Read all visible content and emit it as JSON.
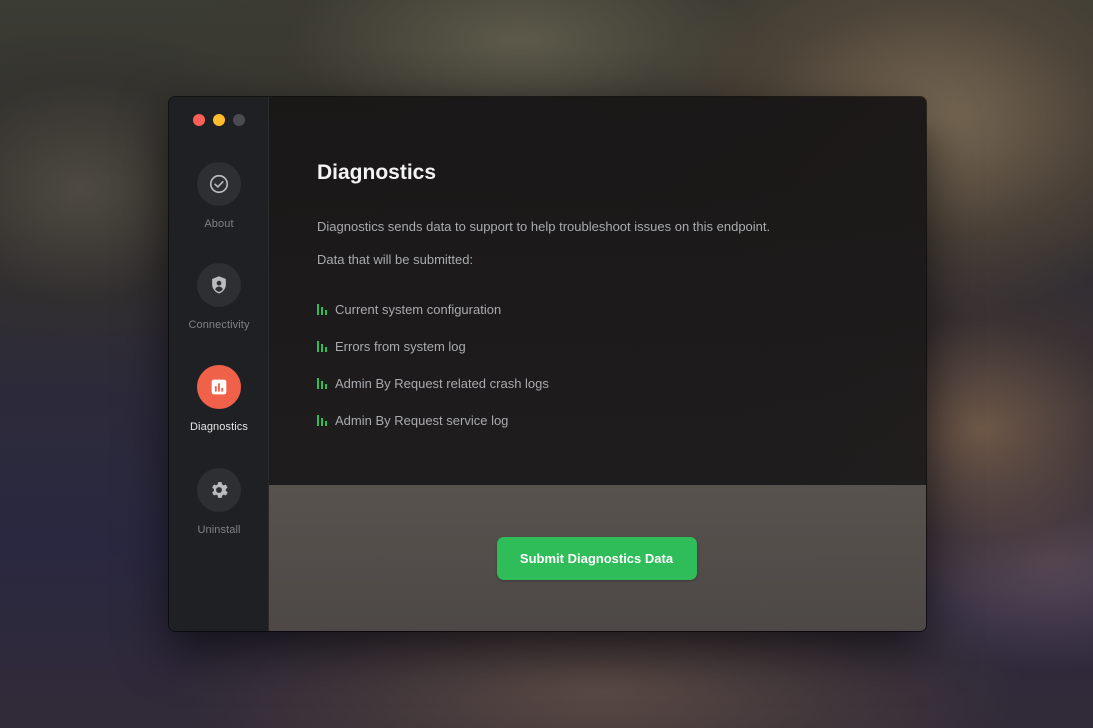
{
  "sidebar": {
    "items": [
      {
        "label": "About",
        "icon": "check-circle-icon",
        "active": false
      },
      {
        "label": "Connectivity",
        "icon": "shield-user-icon",
        "active": false
      },
      {
        "label": "Diagnostics",
        "icon": "bar-chart-icon",
        "active": true
      },
      {
        "label": "Uninstall",
        "icon": "gear-icon",
        "active": false
      }
    ]
  },
  "main": {
    "title": "Diagnostics",
    "description": "Diagnostics sends data to support to help troubleshoot issues on this endpoint.",
    "subheading": "Data that will be submitted:",
    "items": [
      "Current system configuration",
      "Errors from system log",
      "Admin By Request related crash logs",
      "Admin By Request service log"
    ],
    "submit_label": "Submit Diagnostics Data"
  },
  "colors": {
    "accent_active": "#f0614a",
    "submit_green": "#2ebd59",
    "list_icon_green": "#2ebd59",
    "traffic_close": "#fe5f57",
    "traffic_minimize": "#febc2e"
  }
}
